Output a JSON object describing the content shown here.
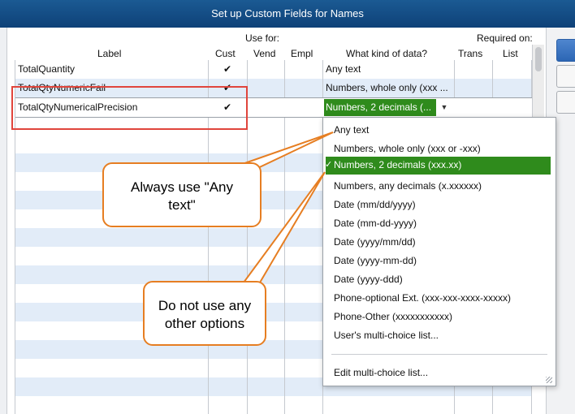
{
  "window": {
    "title": "Set up Custom Fields for Names"
  },
  "header": {
    "use_for": "Use for:",
    "required_on": "Required on:",
    "label": "Label",
    "cust": "Cust",
    "vend": "Vend",
    "empl": "Empl",
    "kind": "What kind of data?",
    "trans": "Trans",
    "list": "List"
  },
  "rows": [
    {
      "label": "TotalQuantity",
      "cust": "✔",
      "kind": "Any text"
    },
    {
      "label": "TotalQtyNumericFail",
      "cust": "✔",
      "kind": "Numbers, whole only (xxx ..."
    },
    {
      "label": "TotalQtyNumericalPrecision",
      "cust": "✔",
      "kind": "Numbers, 2 decimals (..."
    }
  ],
  "dropdown": {
    "items": [
      "Any text",
      "Numbers, whole only (xxx or -xxx)",
      "Numbers, 2 decimals (xxx.xx)",
      "Numbers, any decimals (x.xxxxxx)",
      "Date (mm/dd/yyyy)",
      "Date (mm-dd-yyyy)",
      "Date (yyyy/mm/dd)",
      "Date (yyyy-mm-dd)",
      "Date (yyyy-ddd)",
      "Phone-optional Ext. (xxx-xxx-xxxx-xxxxx)",
      "Phone-Other (xxxxxxxxxxx)",
      "User's multi-choice list..."
    ],
    "selected_index": 2,
    "check": "✓",
    "edit": "Edit multi-choice list..."
  },
  "callouts": {
    "any_text_line1": "Always use \"Any",
    "any_text_line2": "text\"",
    "no_other_line1": "Do not use any",
    "no_other_line2": "other options"
  },
  "colors": {
    "selection": "#2f8b1c",
    "alt_row": "#e2ecf8",
    "callout_border": "#e67e22",
    "highlight_box": "#e0453c",
    "title_bar": "#1b5a93"
  }
}
